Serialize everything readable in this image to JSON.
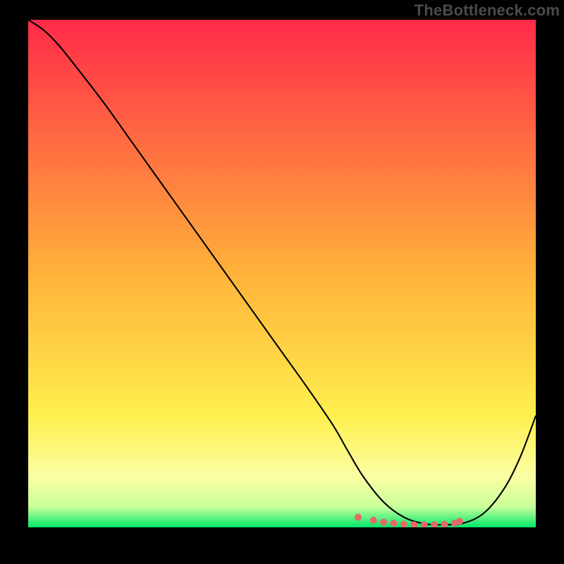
{
  "watermark": "TheBottleneck.com",
  "chart_data": {
    "type": "line",
    "title": "",
    "xlabel": "",
    "ylabel": "",
    "xlim": [
      0,
      100
    ],
    "ylim": [
      0,
      100
    ],
    "bg_gradient": {
      "stops": [
        {
          "offset": 0.0,
          "color": "#ff2a49"
        },
        {
          "offset": 0.5,
          "color": "#ffb23a"
        },
        {
          "offset": 0.78,
          "color": "#ffef4e"
        },
        {
          "offset": 0.9,
          "color": "#fbffa3"
        },
        {
          "offset": 0.96,
          "color": "#c8ff9a"
        },
        {
          "offset": 1.0,
          "color": "#00e86a"
        }
      ]
    },
    "series": [
      {
        "name": "curve",
        "color": "#000000",
        "width": 2.1,
        "x": [
          0,
          3,
          6,
          10,
          15,
          20,
          25,
          30,
          35,
          40,
          45,
          50,
          55,
          60,
          63,
          66,
          70,
          74,
          78,
          82,
          86,
          90,
          94,
          97,
          100
        ],
        "values": [
          100,
          98,
          95,
          90,
          83.5,
          76.5,
          69.5,
          62.5,
          55.5,
          48.5,
          41.5,
          34.5,
          27.5,
          20.2,
          15,
          10,
          5,
          2,
          0.7,
          0.5,
          0.9,
          3,
          8,
          14,
          22
        ]
      }
    ],
    "markers": {
      "name": "flat-region-dots",
      "color": "#e46a6a",
      "radius": 5,
      "x": [
        65,
        68,
        70,
        72,
        74,
        76,
        78,
        80,
        82,
        84,
        85
      ],
      "values": [
        2.0,
        1.4,
        1.0,
        0.8,
        0.6,
        0.5,
        0.5,
        0.5,
        0.6,
        0.8,
        1.2
      ]
    }
  }
}
